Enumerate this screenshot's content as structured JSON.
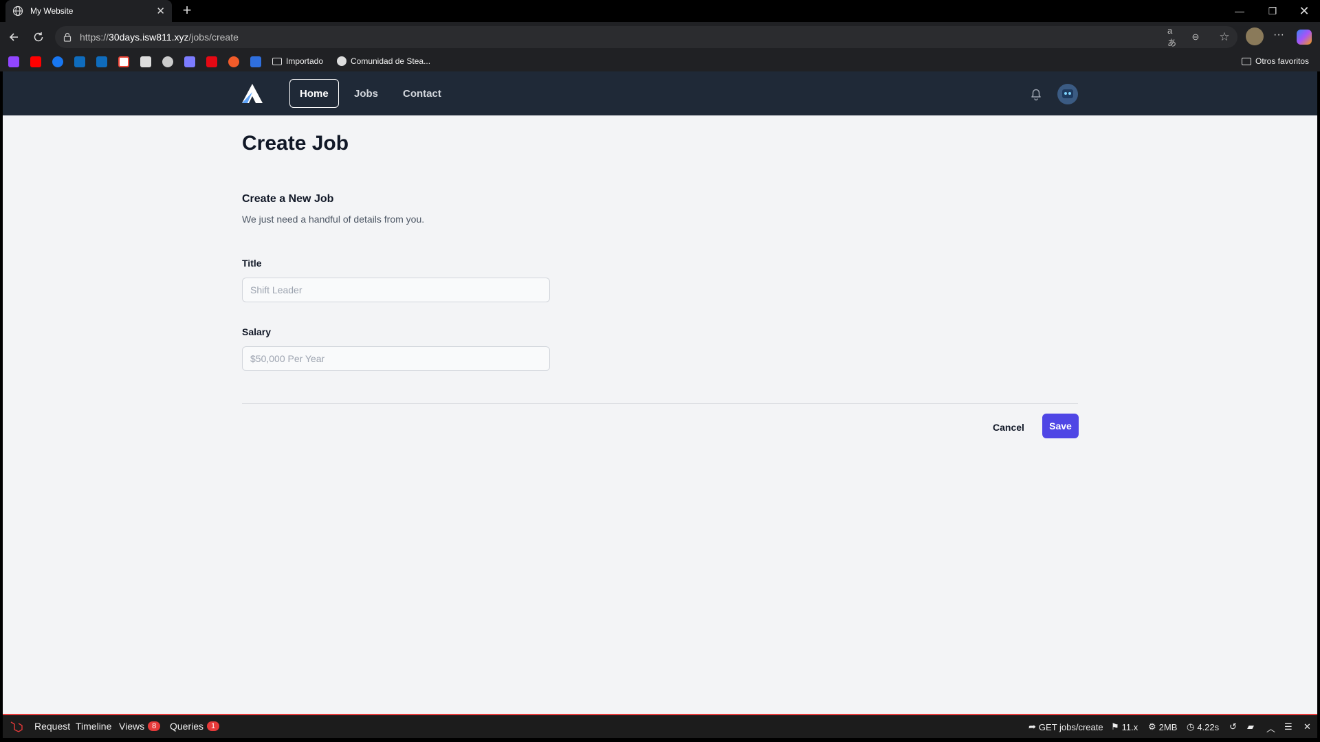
{
  "browser": {
    "tab_title": "My Website",
    "new_tab_symbol": "+",
    "url_prefix": "https://",
    "url_host": "30days.isw811.xyz",
    "url_path": "/jobs/create",
    "bookmarks": {
      "imported": "Importado",
      "steam": "Comunidad de Stea...",
      "other": "Otros favoritos"
    }
  },
  "nav": {
    "home": "Home",
    "jobs": "Jobs",
    "contact": "Contact"
  },
  "page": {
    "heading": "Create Job",
    "section_title": "Create a New Job",
    "section_desc": "We just need a handful of details from you.",
    "title_label": "Title",
    "title_placeholder": "Shift Leader",
    "salary_label": "Salary",
    "salary_placeholder": "$50,000 Per Year",
    "cancel": "Cancel",
    "save": "Save"
  },
  "debugbar": {
    "request": "Request",
    "timeline": "Timeline",
    "views": "Views",
    "views_count": "8",
    "queries": "Queries",
    "queries_count": "1",
    "route": "GET jobs/create",
    "version": "11.x",
    "memory": "2MB",
    "time": "4.22s"
  },
  "colors": {
    "nav_bg": "#1f2937",
    "page_bg": "#f3f4f6",
    "primary": "#4f46e5",
    "debug_accent": "#e63a3a"
  }
}
